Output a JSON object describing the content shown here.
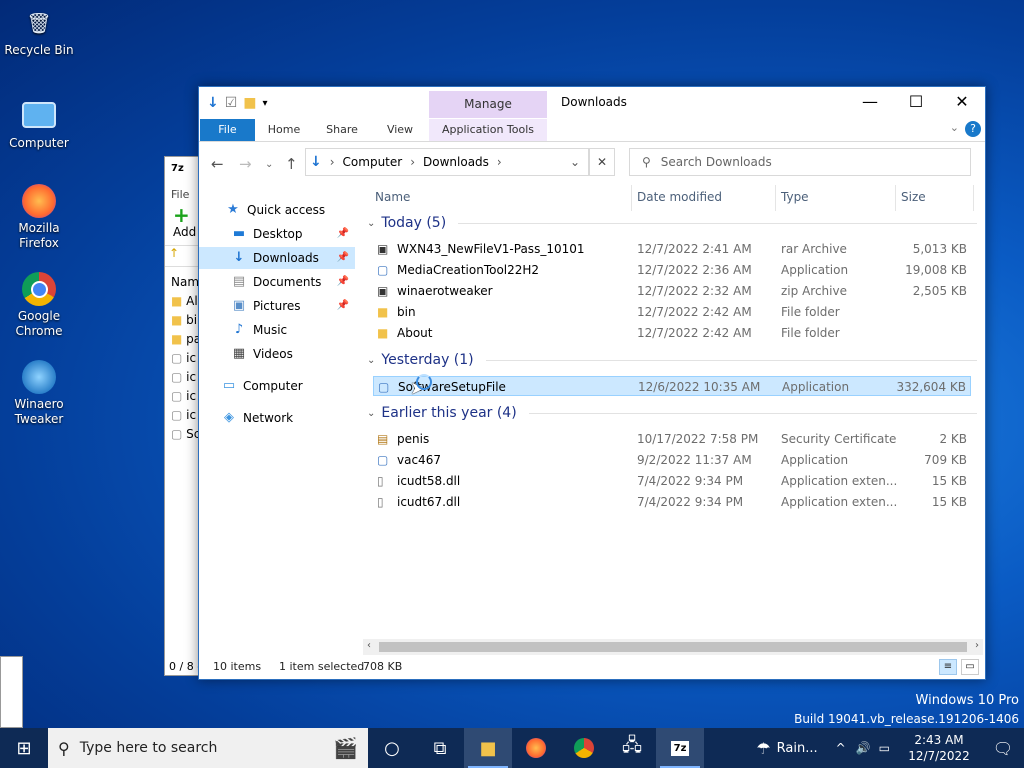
{
  "desktop": {
    "icons": [
      {
        "label": "Recycle Bin"
      },
      {
        "label": "Computer"
      },
      {
        "label": "Mozilla Firefox"
      },
      {
        "label": "Google Chrome"
      },
      {
        "label": "Winaero Tweaker"
      }
    ],
    "watermark": {
      "line1": "Windows 10 Pro",
      "line2": "Build 19041.vb_release.191206-1406"
    }
  },
  "backwindow": {
    "title_icon": "7z",
    "menu": "File",
    "toolbar": "Add",
    "column": "Name",
    "rows": [
      "Al",
      "bi",
      "pa",
      "ic",
      "ic",
      "ic",
      "ic",
      "Sc"
    ],
    "status": "0 / 8 o"
  },
  "explorer": {
    "title": "Downloads",
    "contextual_tab": "Manage",
    "ribbon_tabs": [
      "File",
      "Home",
      "Share",
      "View",
      "Application Tools"
    ],
    "address": {
      "crumbs": [
        "Computer",
        "Downloads"
      ]
    },
    "search_placeholder": "Search Downloads",
    "nav": {
      "quick_access": "Quick access",
      "items": [
        "Desktop",
        "Downloads",
        "Documents",
        "Pictures",
        "Music",
        "Videos"
      ],
      "computer": "Computer",
      "network": "Network"
    },
    "columns": {
      "name": "Name",
      "date": "Date modified",
      "type": "Type",
      "size": "Size"
    },
    "groups": [
      {
        "label": "Today (5)",
        "files": [
          {
            "name": "WXN43_NewFileV1-Pass_10101",
            "date": "12/7/2022 2:41 AM",
            "type": "rar Archive",
            "size": "5,013 KB"
          },
          {
            "name": "MediaCreationTool22H2",
            "date": "12/7/2022 2:36 AM",
            "type": "Application",
            "size": "19,008 KB"
          },
          {
            "name": "winaerotweaker",
            "date": "12/7/2022 2:32 AM",
            "type": "zip Archive",
            "size": "2,505 KB"
          },
          {
            "name": "bin",
            "date": "12/7/2022 2:42 AM",
            "type": "File folder",
            "size": ""
          },
          {
            "name": "About",
            "date": "12/7/2022 2:42 AM",
            "type": "File folder",
            "size": ""
          }
        ]
      },
      {
        "label": "Yesterday (1)",
        "files": [
          {
            "name": "SoftwareSetupFile",
            "date": "12/6/2022 10:35 AM",
            "type": "Application",
            "size": "332,604 KB"
          }
        ]
      },
      {
        "label": "Earlier this year (4)",
        "files": [
          {
            "name": "penis",
            "date": "10/17/2022 7:58 PM",
            "type": "Security Certificate",
            "size": "2 KB"
          },
          {
            "name": "vac467",
            "date": "9/2/2022 11:37 AM",
            "type": "Application",
            "size": "709 KB"
          },
          {
            "name": "icudt58.dll",
            "date": "7/4/2022 9:34 PM",
            "type": "Application exten...",
            "size": "15 KB"
          },
          {
            "name": "icudt67.dll",
            "date": "7/4/2022 9:34 PM",
            "type": "Application exten...",
            "size": "15 KB"
          }
        ]
      }
    ],
    "status": {
      "items": "10 items",
      "selected": "1 item selected",
      "size": "708 KB"
    }
  },
  "taskbar": {
    "search_placeholder": "Type here to search",
    "weather": "Rain...",
    "time": "2:43 AM",
    "date": "12/7/2022"
  }
}
